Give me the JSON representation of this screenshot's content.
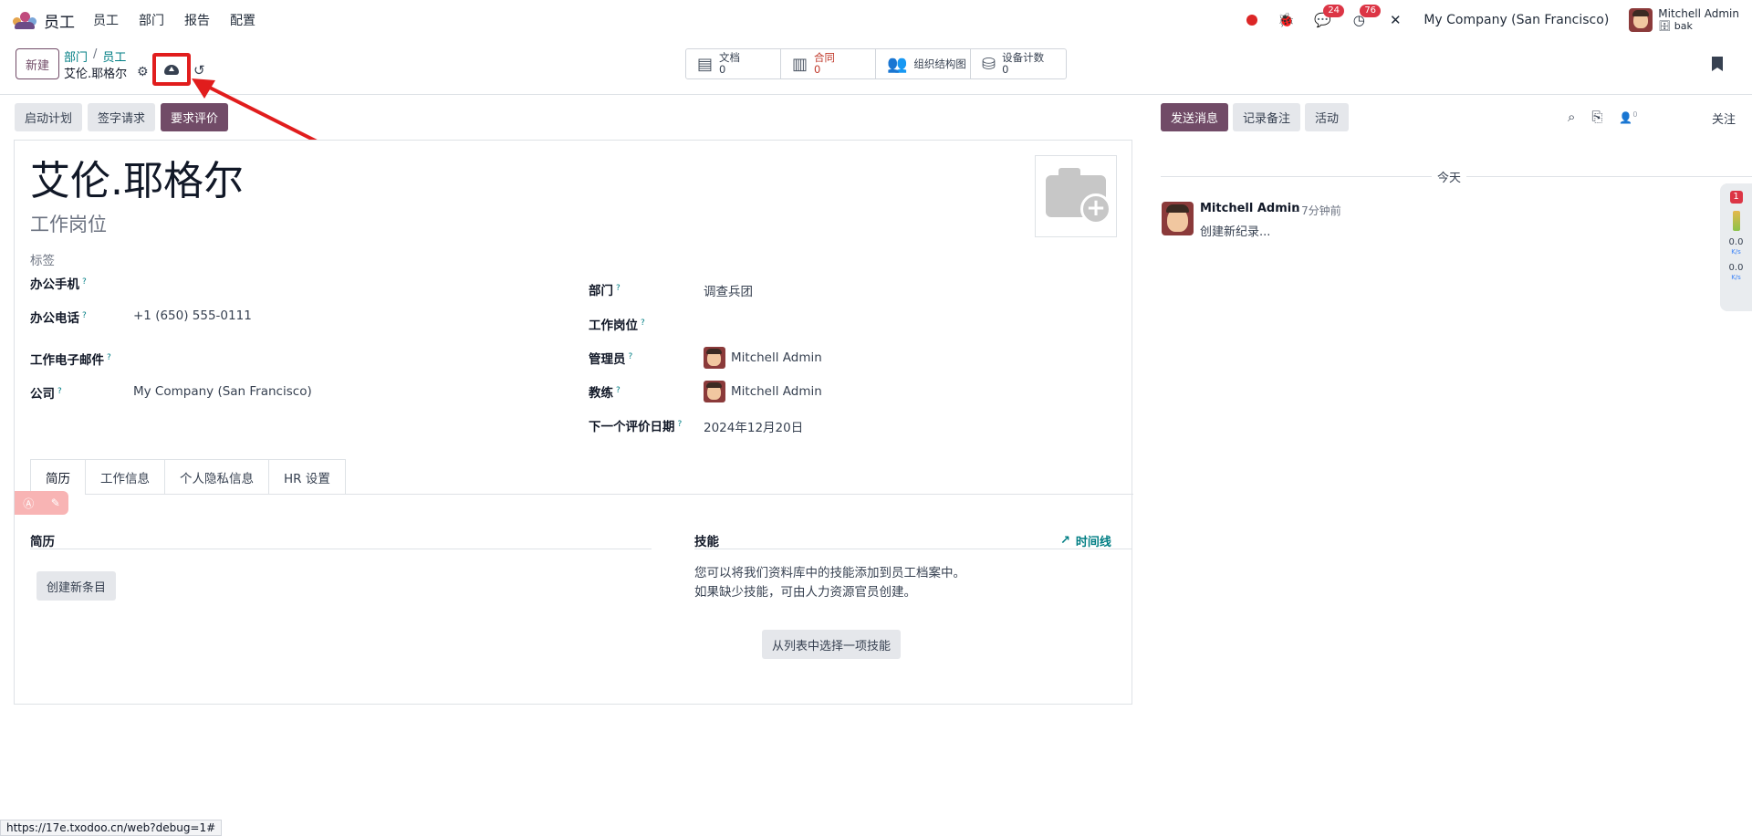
{
  "navbar": {
    "app_name": "员工",
    "menu": [
      "员工",
      "部门",
      "报告",
      "配置"
    ],
    "messages_count": "24",
    "activities_count": "76",
    "company": "My Company (San Francisco)",
    "user_name": "Mitchell Admin",
    "user_db": "bak"
  },
  "control": {
    "new_label": "新建",
    "breadcrumb": [
      "部门",
      "员工"
    ],
    "record_name": "艾伦.耶格尔",
    "smart_buttons": [
      {
        "label": "文档",
        "value": "0",
        "icon": "document-icon"
      },
      {
        "label": "合同",
        "value": "0",
        "icon": "contract-icon"
      },
      {
        "label": "组织结构图",
        "value": "",
        "icon": "org-chart-icon"
      },
      {
        "label": "设备计数",
        "value": "0",
        "icon": "equipment-icon"
      }
    ]
  },
  "status_buttons": [
    "启动计划",
    "签字请求",
    "要求评价"
  ],
  "employee": {
    "name": "艾伦.耶格尔",
    "job_placeholder": "工作岗位",
    "tags_placeholder": "标签"
  },
  "fields_left": [
    {
      "label": "办公手机",
      "value": ""
    },
    {
      "label": "办公电话",
      "value": "+1 (650) 555-0111"
    },
    {
      "label": "工作电子邮件",
      "value": ""
    },
    {
      "label": "公司",
      "value": "My Company (San Francisco)"
    }
  ],
  "fields_right": [
    {
      "label": "部门",
      "value": "调查兵团"
    },
    {
      "label": "工作岗位",
      "value": ""
    },
    {
      "label": "管理员",
      "value": "Mitchell Admin"
    },
    {
      "label": "教练",
      "value": "Mitchell Admin"
    },
    {
      "label": "下一个评价日期",
      "value": "2024年12月20日"
    }
  ],
  "tabs": [
    "简历",
    "工作信息",
    "个人隐私信息",
    "HR 设置"
  ],
  "resume": {
    "title": "简历",
    "create_label": "创建新条目"
  },
  "skills": {
    "title": "技能",
    "timeline_label": "时间线",
    "text_line1": "您可以将我们资料库中的技能添加到员工档案中。",
    "text_line2": "如果缺少技能，可由人力资源官员创建。",
    "pick_label": "从列表中选择一项技能"
  },
  "chatter": {
    "send_label": "发送消息",
    "note_label": "记录备注",
    "activity_label": "活动",
    "followers_count": "0",
    "follow_label": "关注",
    "today_label": "今天",
    "message": {
      "author": "Mitchell Admin",
      "time": "- 7分钟前",
      "body": "创建新纪录..."
    }
  },
  "side_widget": {
    "badge": "1",
    "up_speed": "0.0",
    "down_speed": "0.0",
    "unit": "K/s"
  },
  "status_url": "https://17e.txodoo.cn/web?debug=1#",
  "colors": {
    "primary": "#714b67",
    "link": "#017e84",
    "annotation": "#e11d1d"
  }
}
